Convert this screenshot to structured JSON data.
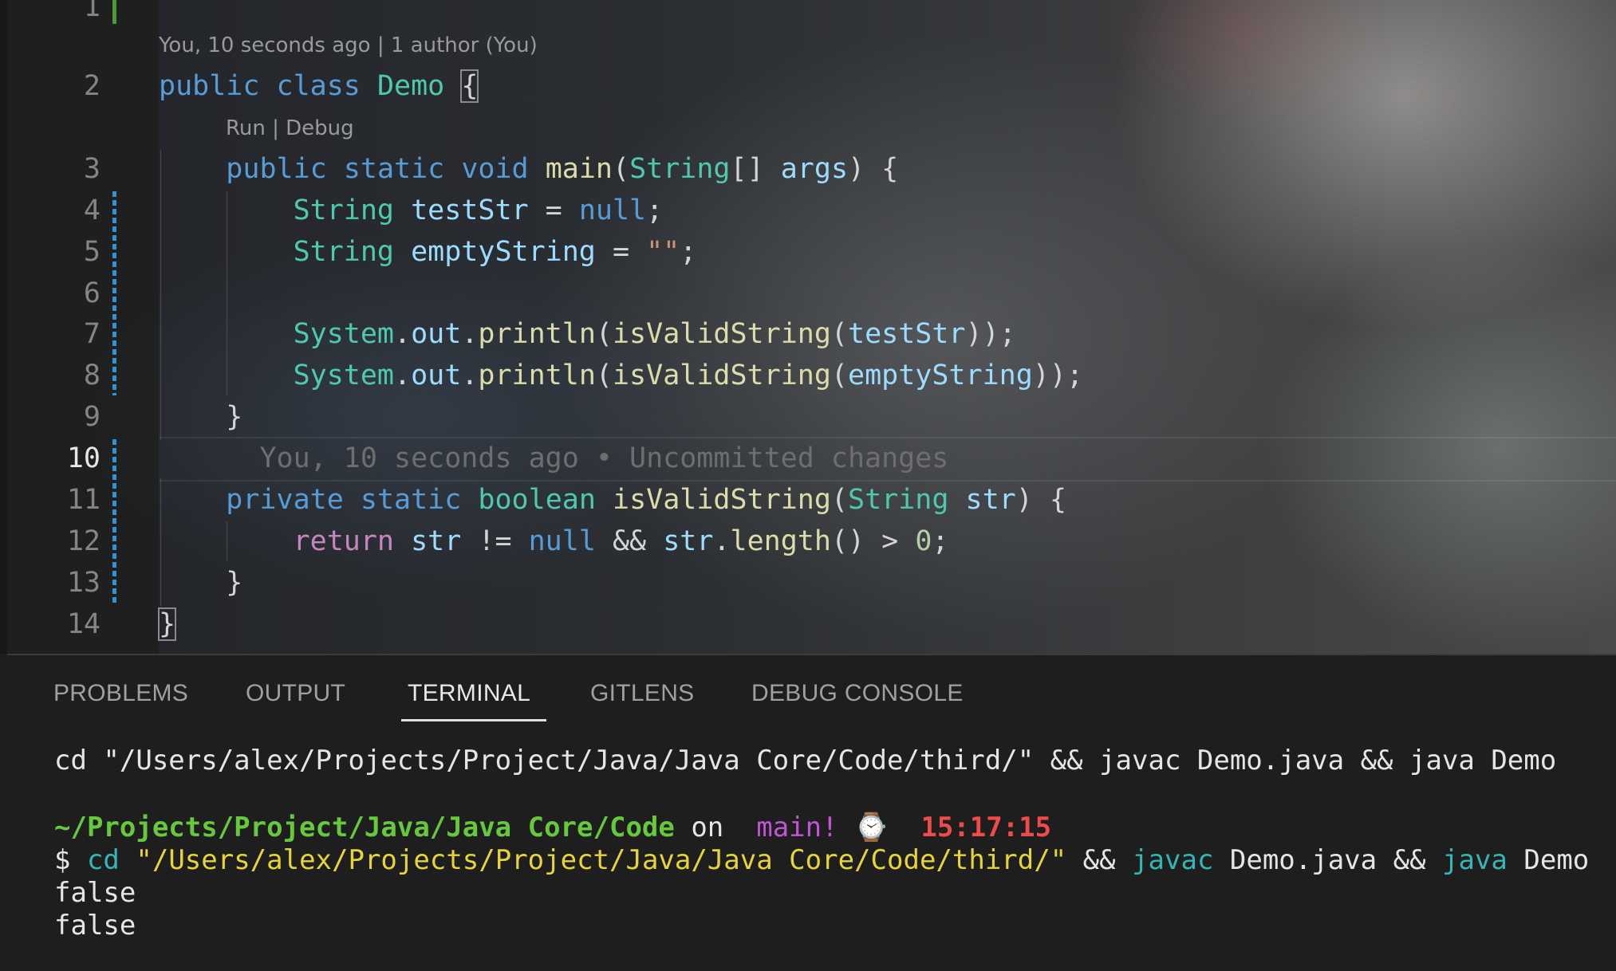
{
  "editor": {
    "git_lens_header": "You, 10 seconds ago | 1 author (You)",
    "run_debug": "Run | Debug",
    "inline_blame": "You, 10 seconds ago • Uncommitted changes",
    "line_numbers": [
      "1",
      "2",
      "3",
      "4",
      "5",
      "6",
      "7",
      "8",
      "9",
      "10",
      "11",
      "12",
      "13",
      "14"
    ],
    "active_line": "10",
    "code": {
      "l2": {
        "public": "public",
        "class": "class",
        "name": "Demo",
        "brace": "{"
      },
      "l3": {
        "public": "public",
        "static": "static",
        "void": "void",
        "main": "main",
        "open": "(",
        "type": "String",
        "arr": "[] ",
        "args": "args",
        "close": ") {"
      },
      "l4": {
        "type": "String",
        "var": "testStr",
        "eq": " = ",
        "nul": "null",
        "semi": ";"
      },
      "l5": {
        "type": "String",
        "var": "emptyString",
        "eq": " = ",
        "str": "\"\"",
        "semi": ";"
      },
      "l7": {
        "sys": "System",
        "dot1": ".",
        "out": "out",
        "dot2": ".",
        "println": "println",
        "p1": "(",
        "fn": "isValidString",
        "p2": "(",
        "arg": "testStr",
        "end": "));"
      },
      "l8": {
        "sys": "System",
        "dot1": ".",
        "out": "out",
        "dot2": ".",
        "println": "println",
        "p1": "(",
        "fn": "isValidString",
        "p2": "(",
        "arg": "emptyString",
        "end": "));"
      },
      "l9": {
        "brace": "}"
      },
      "l11": {
        "private": "private",
        "static": "static",
        "bool": "boolean",
        "fn": "isValidString",
        "open": "(",
        "type": "String",
        "param": "str",
        "close": ") {"
      },
      "l12": {
        "ret": "return",
        "str1": "str",
        "ne": " != ",
        "nul": "null",
        "and": " && ",
        "str2": "str",
        "dot": ".",
        "len": "length",
        "parens": "()",
        "gt": " > ",
        "zero": "0",
        "semi": ";"
      },
      "l13": {
        "brace": "}"
      },
      "l14": {
        "brace": "}"
      }
    }
  },
  "panel": {
    "tabs": [
      "PROBLEMS",
      "OUTPUT",
      "TERMINAL",
      "GITLENS",
      "DEBUG CONSOLE"
    ],
    "active_tab": "TERMINAL"
  },
  "terminal": {
    "command_echo": "cd \"/Users/alex/Projects/Project/Java/Java Core/Code/third/\" && javac Demo.java && java Demo",
    "prompt": {
      "path": "~/Projects/Project/Java/Java Core/Code",
      "on": " on ",
      "branch_icon": "",
      "branch": " main!",
      "clock_icon": "⌚",
      "time": "15:17:15"
    },
    "command": {
      "dollar": "$ ",
      "cd": "cd",
      "path": "\"/Users/alex/Projects/Project/Java/Java Core/Code/third/\"",
      "and1": " && ",
      "javac": "javac",
      "file": " Demo.java",
      "and2": " && ",
      "java": "java",
      "cls": " Demo"
    },
    "output": [
      "false",
      "false"
    ]
  }
}
